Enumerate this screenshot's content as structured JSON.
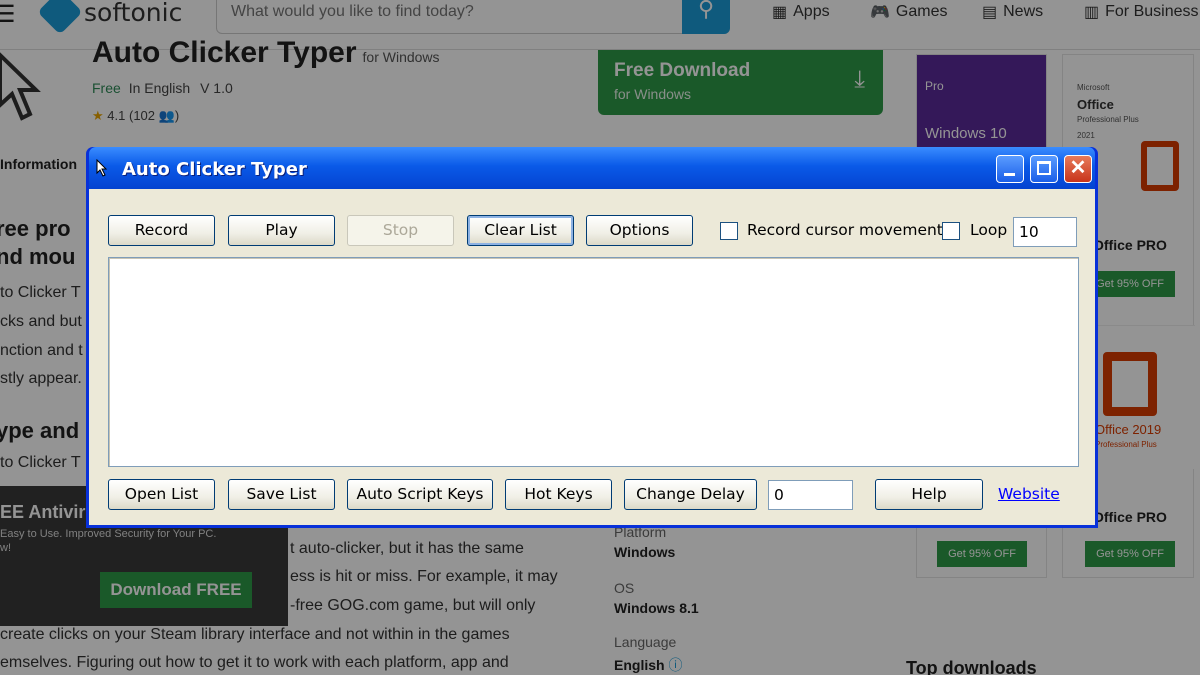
{
  "site": {
    "logo_text": "softonic",
    "search_placeholder": "What would you like to find today?",
    "nav": [
      {
        "label": "Apps",
        "icon": "grid-icon"
      },
      {
        "label": "Games",
        "icon": "gamepad-icon"
      },
      {
        "label": "News",
        "icon": "news-icon"
      },
      {
        "label": "For Business",
        "icon": "chart-icon"
      }
    ]
  },
  "app_page": {
    "title": "Auto Clicker Typer",
    "platform_note": "for Windows",
    "meta": {
      "price": "Free",
      "language": "In English",
      "version": "V 1.0"
    },
    "rating": "4.1",
    "rating_count": "(102",
    "download": {
      "label": "Free Download",
      "sub": "for Windows"
    },
    "info_tab": "Information",
    "article_lines": [
      {
        "type": "h",
        "text": "ree pro"
      },
      {
        "type": "h",
        "text": "nd mou"
      },
      {
        "type": "p",
        "text": "to Clicker T"
      },
      {
        "type": "p",
        "text": "cks and but"
      },
      {
        "type": "p",
        "text": "nction and t"
      },
      {
        "type": "p",
        "text": "stly appear."
      },
      {
        "type": "h",
        "text": "ype and c"
      },
      {
        "type": "p",
        "text": "to Clicker T"
      }
    ],
    "article_tail": [
      "t auto-clicker, but it has the same",
      "ess is hit or miss. For example, it may",
      "-free GOG.com game, but will only",
      "create clicks on your Steam library interface and not within in the games",
      "emselves. Figuring out how to get it to work with each platform, app and"
    ],
    "promo": {
      "heading": "EE Antiviru",
      "sub": "Easy to Use. Improved Security for Your PC.",
      "sub2": "w!",
      "button": "Download FREE"
    },
    "specs": [
      {
        "label": "Platform",
        "value": "Windows"
      },
      {
        "label": "OS",
        "value": "Windows 8.1"
      },
      {
        "label": "Language",
        "value": "English"
      }
    ],
    "ads": [
      {
        "name": "",
        "pre": "Pro",
        "img_text": "Windows 10",
        "button": ""
      },
      {
        "name": "Office PRO",
        "img_text": "Office",
        "img_sub": "Professional Plus",
        "img_year": "2021",
        "button": "Get 95% OFF",
        "brand": "Microsoft"
      },
      {
        "name": "Office PRO",
        "img_text": "Office 2019",
        "img_sub": "Professional Plus",
        "button": "Get 95% OFF"
      },
      {
        "name": "",
        "button": "Get 95% OFF"
      }
    ],
    "top_downloads": "Top downloads"
  },
  "window": {
    "title": "Auto Clicker Typer",
    "buttons_top": {
      "record": "Record",
      "play": "Play",
      "stop": "Stop",
      "clear": "Clear List",
      "options": "Options"
    },
    "record_cursor_label": "Record cursor movement",
    "record_cursor_checked": false,
    "loop_label": "Loop",
    "loop_checked": false,
    "loop_value": "10",
    "buttons_bottom": {
      "open": "Open List",
      "save": "Save List",
      "auto_script": "Auto Script Keys",
      "hot_keys": "Hot Keys",
      "change_delay": "Change Delay",
      "help": "Help"
    },
    "delay_value": "0",
    "website_link": "Website"
  }
}
